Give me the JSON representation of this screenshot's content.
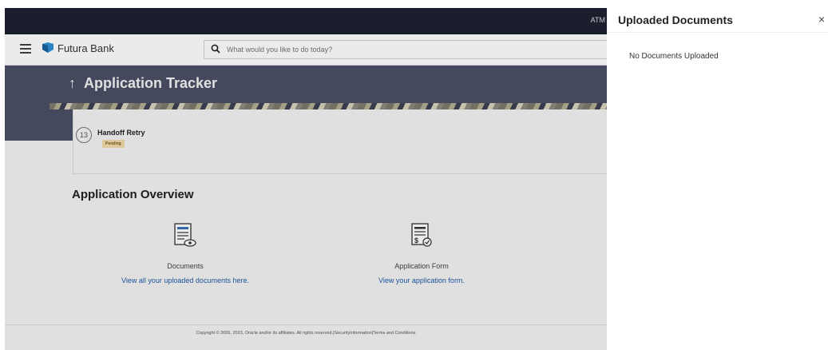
{
  "topbar": {
    "atm_label": "ATM"
  },
  "header": {
    "brand": "Futura Bank",
    "search_placeholder": "What would you like to do today?"
  },
  "page": {
    "back_arrow": "↑",
    "title": "Application Tracker"
  },
  "tracker": {
    "step_number": "13",
    "step_title": "Handoff Retry",
    "step_status": "Pending"
  },
  "overview": {
    "heading": "Application Overview",
    "tiles": [
      {
        "label": "Documents",
        "link": "View all your uploaded documents here.",
        "icon": "document-view-icon"
      },
      {
        "label": "Application Form",
        "link": "View your application form.",
        "icon": "application-form-icon"
      }
    ]
  },
  "footer": {
    "copyright": "Copyright © 2006, 2023, Oracle and/or its affiliates. All rights reserved.|SecurityInformation|Terms and Conditions"
  },
  "panel": {
    "title": "Uploaded Documents",
    "close_label": "×",
    "empty_message": "No Documents Uploaded"
  },
  "colors": {
    "topbar": "#1e2130",
    "hero": "#4a5067",
    "link": "#1f5ba8",
    "badge_bg": "#efd9a8",
    "logo": "#2f8fd6"
  }
}
